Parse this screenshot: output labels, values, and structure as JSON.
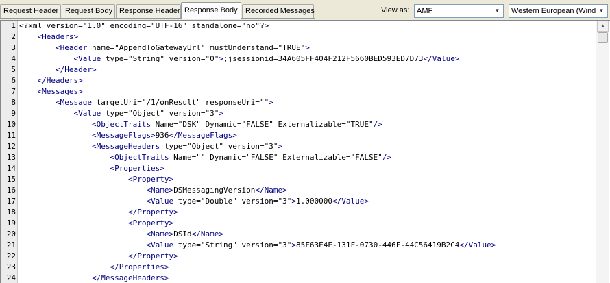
{
  "tabs": [
    {
      "label": "Request Header"
    },
    {
      "label": "Request Body"
    },
    {
      "label": "Response Header"
    },
    {
      "label": "Response Body",
      "active": true
    },
    {
      "label": "Recorded Messages"
    }
  ],
  "view_as": {
    "label": "View as:",
    "format_value": "AMF",
    "encoding_value": "Western European (Windo"
  },
  "editor": {
    "lines": [
      {
        "n": "1",
        "segs": [
          {
            "t": "<?xml version=\"1.0\" encoding=\"UTF-16\" standalone=\"no\"?>"
          }
        ]
      },
      {
        "n": "2",
        "segs": [
          {
            "t": "    "
          },
          {
            "t": "<Headers>",
            "c": "tg"
          }
        ]
      },
      {
        "n": "3",
        "segs": [
          {
            "t": "        "
          },
          {
            "t": "<Header",
            "c": "tg"
          },
          {
            "t": " name=\"AppendToGatewayUrl\" mustUnderstand=\"TRUE\""
          },
          {
            "t": ">",
            "c": "tg"
          }
        ]
      },
      {
        "n": "4",
        "segs": [
          {
            "t": "            "
          },
          {
            "t": "<Value",
            "c": "tg"
          },
          {
            "t": " type=\"String\" version=\"0\""
          },
          {
            "t": ">",
            "c": "tg"
          },
          {
            "t": ";jsessionid=34A605FF404F212F5660BED593ED7D73"
          },
          {
            "t": "</Value>",
            "c": "tg"
          }
        ]
      },
      {
        "n": "5",
        "segs": [
          {
            "t": "        "
          },
          {
            "t": "</Header>",
            "c": "tg"
          }
        ]
      },
      {
        "n": "6",
        "segs": [
          {
            "t": "    "
          },
          {
            "t": "</Headers>",
            "c": "tg"
          }
        ]
      },
      {
        "n": "7",
        "segs": [
          {
            "t": "    "
          },
          {
            "t": "<Messages>",
            "c": "tg"
          }
        ]
      },
      {
        "n": "8",
        "segs": [
          {
            "t": "        "
          },
          {
            "t": "<Message",
            "c": "tg"
          },
          {
            "t": " targetUri=\"/1/onResult\" responseUri=\"\""
          },
          {
            "t": ">",
            "c": "tg"
          }
        ]
      },
      {
        "n": "9",
        "segs": [
          {
            "t": "            "
          },
          {
            "t": "<Value",
            "c": "tg"
          },
          {
            "t": " type=\"Object\" version=\"3\""
          },
          {
            "t": ">",
            "c": "tg"
          }
        ]
      },
      {
        "n": "10",
        "segs": [
          {
            "t": "                "
          },
          {
            "t": "<ObjectTraits",
            "c": "tg"
          },
          {
            "t": " Name=\"DSK\" Dynamic=\"FALSE\" Externalizable=\"TRUE\""
          },
          {
            "t": "/>",
            "c": "tg"
          }
        ]
      },
      {
        "n": "11",
        "segs": [
          {
            "t": "                "
          },
          {
            "t": "<MessageFlags>",
            "c": "tg"
          },
          {
            "t": "936"
          },
          {
            "t": "</MessageFlags>",
            "c": "tg"
          }
        ]
      },
      {
        "n": "12",
        "segs": [
          {
            "t": "                "
          },
          {
            "t": "<MessageHeaders",
            "c": "tg"
          },
          {
            "t": " type=\"Object\" version=\"3\""
          },
          {
            "t": ">",
            "c": "tg"
          }
        ]
      },
      {
        "n": "13",
        "segs": [
          {
            "t": "                    "
          },
          {
            "t": "<ObjectTraits",
            "c": "tg"
          },
          {
            "t": " Name=\"\" Dynamic=\"FALSE\" Externalizable=\"FALSE\""
          },
          {
            "t": "/>",
            "c": "tg"
          }
        ]
      },
      {
        "n": "14",
        "segs": [
          {
            "t": "                    "
          },
          {
            "t": "<Properties>",
            "c": "tg"
          }
        ]
      },
      {
        "n": "15",
        "segs": [
          {
            "t": "                        "
          },
          {
            "t": "<Property>",
            "c": "tg"
          }
        ]
      },
      {
        "n": "16",
        "segs": [
          {
            "t": "                            "
          },
          {
            "t": "<Name>",
            "c": "tg"
          },
          {
            "t": "DSMessagingVersion"
          },
          {
            "t": "</Name>",
            "c": "tg"
          }
        ]
      },
      {
        "n": "17",
        "segs": [
          {
            "t": "                            "
          },
          {
            "t": "<Value",
            "c": "tg"
          },
          {
            "t": " type=\"Double\" version=\"3\""
          },
          {
            "t": ">",
            "c": "tg"
          },
          {
            "t": "1.000000"
          },
          {
            "t": "</Value>",
            "c": "tg"
          }
        ]
      },
      {
        "n": "18",
        "segs": [
          {
            "t": "                        "
          },
          {
            "t": "</Property>",
            "c": "tg"
          }
        ]
      },
      {
        "n": "19",
        "segs": [
          {
            "t": "                        "
          },
          {
            "t": "<Property>",
            "c": "tg"
          }
        ]
      },
      {
        "n": "20",
        "segs": [
          {
            "t": "                            "
          },
          {
            "t": "<Name>",
            "c": "tg"
          },
          {
            "t": "DSId"
          },
          {
            "t": "</Name>",
            "c": "tg"
          }
        ]
      },
      {
        "n": "21",
        "segs": [
          {
            "t": "                            "
          },
          {
            "t": "<Value",
            "c": "tg"
          },
          {
            "t": " type=\"String\" version=\"3\""
          },
          {
            "t": ">",
            "c": "tg"
          },
          {
            "t": "85F63E4E-131F-0730-446F-44C56419B2C4"
          },
          {
            "t": "</Value>",
            "c": "tg"
          }
        ]
      },
      {
        "n": "22",
        "segs": [
          {
            "t": "                        "
          },
          {
            "t": "</Property>",
            "c": "tg"
          }
        ]
      },
      {
        "n": "23",
        "segs": [
          {
            "t": "                    "
          },
          {
            "t": "</Properties>",
            "c": "tg"
          }
        ]
      },
      {
        "n": "24",
        "segs": [
          {
            "t": "                "
          },
          {
            "t": "</MessageHeaders>",
            "c": "tg"
          }
        ]
      }
    ]
  },
  "colors": {
    "tag": "#000080",
    "text": "#000000",
    "gutter_bg": "#ececec"
  }
}
